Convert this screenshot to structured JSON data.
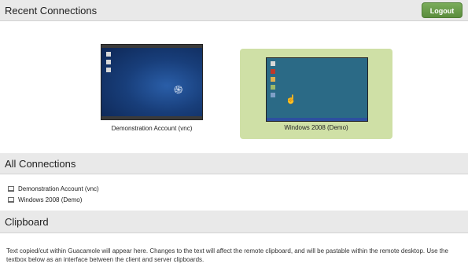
{
  "recent": {
    "title": "Recent Connections",
    "logout_label": "Logout",
    "connections": [
      {
        "label": "Demonstration Account (vnc)",
        "selected": false
      },
      {
        "label": "Windows 2008 (Demo)",
        "selected": true
      }
    ]
  },
  "all": {
    "title": "All Connections",
    "items": [
      {
        "label": "Demonstration Account (vnc)"
      },
      {
        "label": "Windows 2008 (Demo)"
      }
    ]
  },
  "clipboard": {
    "title": "Clipboard",
    "description": "Text copied/cut within Guacamole will appear here. Changes to the text will affect the remote clipboard, and will be pastable within the remote desktop. Use the textbox below as an interface between the client and server clipboards."
  },
  "colors": {
    "header_bg": "#e9e9e9",
    "accent_green": "#5b8d3e",
    "selected_bg": "#cfe0a6",
    "linux_desktop": "#183e7a",
    "windows_desktop": "#2b6a86"
  }
}
